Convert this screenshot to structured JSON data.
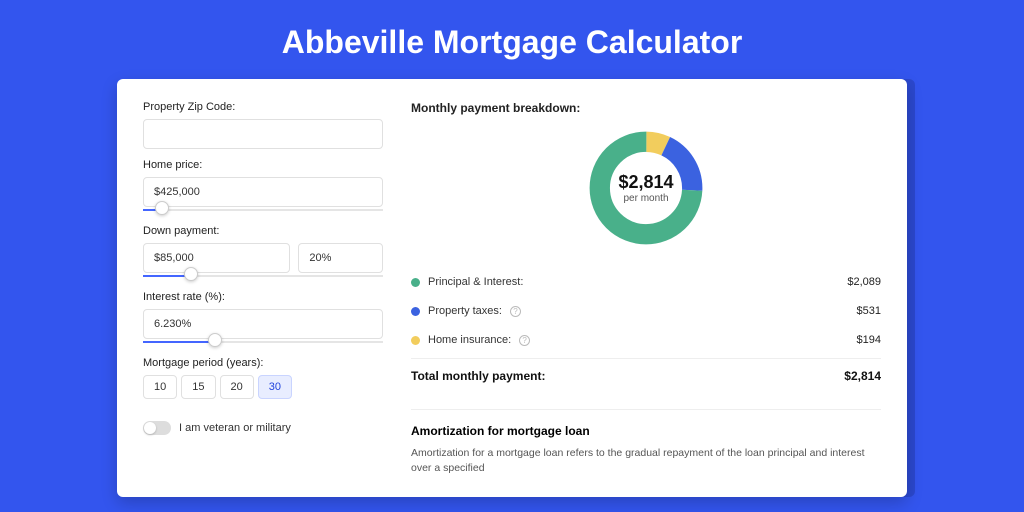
{
  "title": "Abbeville Mortgage Calculator",
  "form": {
    "zip_label": "Property Zip Code:",
    "zip_value": "",
    "home_price_label": "Home price:",
    "home_price_value": "$425,000",
    "down_label": "Down payment:",
    "down_value": "$85,000",
    "down_pct": "20%",
    "rate_label": "Interest rate (%):",
    "rate_value": "6.230%",
    "period_label": "Mortgage period (years):",
    "periods": [
      "10",
      "15",
      "20",
      "30"
    ],
    "period_selected": "30",
    "veteran_label": "I am veteran or military"
  },
  "breakdown": {
    "title": "Monthly payment breakdown:",
    "total_amount": "$2,814",
    "per_month": "per month",
    "items": [
      {
        "label": "Principal & Interest:",
        "value": "$2,089",
        "color": "green"
      },
      {
        "label": "Property taxes:",
        "value": "$531",
        "color": "blue",
        "info": true
      },
      {
        "label": "Home insurance:",
        "value": "$194",
        "color": "yellow",
        "info": true
      }
    ],
    "total_label": "Total monthly payment:",
    "total_value": "$2,814"
  },
  "amortization": {
    "title": "Amortization for mortgage loan",
    "body": "Amortization for a mortgage loan refers to the gradual repayment of the loan principal and interest over a specified"
  },
  "chart_data": {
    "type": "pie",
    "title": "Monthly payment breakdown",
    "total": 2814,
    "series": [
      {
        "name": "Principal & Interest",
        "value": 2089,
        "color": "#49b08a"
      },
      {
        "name": "Property taxes",
        "value": 531,
        "color": "#3b62e0"
      },
      {
        "name": "Home insurance",
        "value": 194,
        "color": "#f2cd5d"
      }
    ]
  }
}
